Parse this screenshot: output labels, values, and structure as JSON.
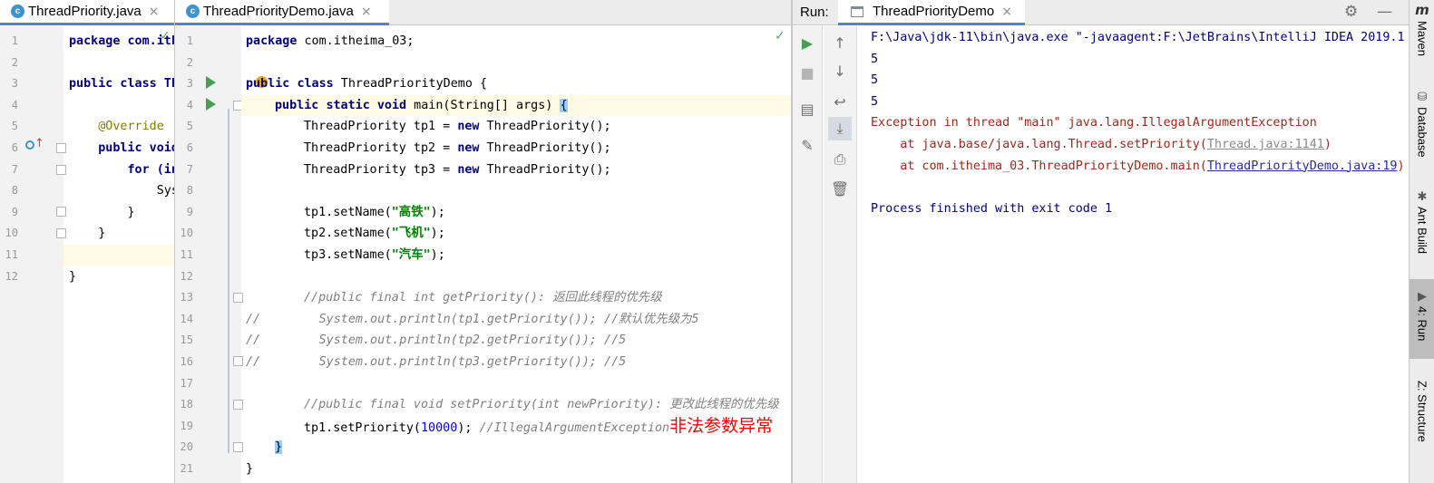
{
  "left_editor": {
    "tab": {
      "icon": "class-icon",
      "icon_letter": "c",
      "label": "ThreadPriority.java"
    },
    "line_numbers": [
      "1",
      "2",
      "3",
      "4",
      "5",
      "6",
      "7",
      "8",
      "9",
      "10",
      "11",
      "12"
    ],
    "lines": [
      "package com.ith",
      "",
      "public class Th",
      "",
      "    @Override",
      "    public void",
      "        for (in",
      "            Sys",
      "        }",
      "    }",
      "",
      "}"
    ]
  },
  "main_editor": {
    "tab": {
      "icon": "class-icon",
      "icon_letter": "c",
      "label": "ThreadPriorityDemo.java"
    },
    "line_numbers": [
      "1",
      "2",
      "3",
      "4",
      "5",
      "6",
      "7",
      "8",
      "9",
      "10",
      "11",
      "12",
      "13",
      "14",
      "15",
      "16",
      "17",
      "18",
      "19",
      "20",
      "21"
    ],
    "code": {
      "l1_kw": "package",
      "l1_rest": " com.itheima_03;",
      "l3_kw1": "public",
      "l3_kw2": "class",
      "l3_rest": " ThreadPriorityDemo {",
      "l4_kw1": "public",
      "l4_kw2": "static",
      "l4_kw3": "void",
      "l4_rest": " main(String[] args) ",
      "l4_brace": "{",
      "l5_a": "ThreadPriority tp1 = ",
      "l5_kw": "new",
      "l5_b": " ThreadPriority();",
      "l6_a": "ThreadPriority tp2 = ",
      "l6_kw": "new",
      "l6_b": " ThreadPriority();",
      "l7_a": "ThreadPriority tp3 = ",
      "l7_kw": "new",
      "l7_b": " ThreadPriority();",
      "l9_a": "tp1.setName(",
      "l9_str": "\"高铁\"",
      "l9_b": ");",
      "l10_a": "tp2.setName(",
      "l10_str": "\"飞机\"",
      "l10_b": ");",
      "l11_a": "tp3.setName(",
      "l11_str": "\"汽车\"",
      "l11_b": ");",
      "l13": "//public final int getPriority(): 返回此线程的优先级",
      "l14": "//        System.out.println(tp1.getPriority()); //默认优先级为5",
      "l15": "//        System.out.println(tp2.getPriority()); //5",
      "l16": "//        System.out.println(tp3.getPriority()); //5",
      "l18": "//public final void setPriority(int newPriority): 更改此线程的优先级",
      "l19_a": "tp1.setPriority(",
      "l19_num": "10000",
      "l19_b": "); ",
      "l19_cmt": "//IllegalArgumentException",
      "l19_red": "非法参数异常",
      "l20": "}",
      "l21": "}"
    }
  },
  "run_panel": {
    "label": "Run:",
    "tab": {
      "icon": "console-icon",
      "label": "ThreadPriorityDemo"
    },
    "output": {
      "cmd": "F:\\Java\\jdk-11\\bin\\java.exe \"-javaagent:F:\\JetBrains\\IntelliJ IDEA 2019.1",
      "out1": "5",
      "out2": "5",
      "out3": "5",
      "exc": "Exception in thread \"main\" java.lang.IllegalArgumentException",
      "at1_pre": "    at java.base/java.lang.Thread.setPriority(",
      "at1_link": "Thread.java:1141",
      "at1_post": ")",
      "at2_pre": "    at com.itheima_03.ThreadPriorityDemo.main(",
      "at2_link": "ThreadPriorityDemo.java:19",
      "at2_post": ")",
      "finished": "Process finished with exit code 1"
    }
  },
  "right_sidebar": {
    "logo_letter": "m",
    "tabs": [
      "Maven",
      "Database",
      "Ant Build",
      "4: Run",
      "Z: Structure"
    ]
  }
}
